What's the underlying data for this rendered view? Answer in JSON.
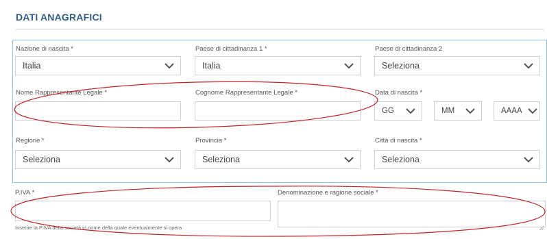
{
  "section": {
    "title": "DATI ANAGRAFICI"
  },
  "fields": {
    "nazione_nascita": {
      "label": "Nazione di nascita  *",
      "value": "Italia"
    },
    "paese_cittadinanza_1": {
      "label": "Paese di cittadinanza 1  *",
      "value": "Italia"
    },
    "paese_cittadinanza_2": {
      "label": "Paese di cittadinanza 2",
      "value": "Seleziona"
    },
    "nome_rappresentante": {
      "label": "Nome Rappresentante Legale *",
      "value": ""
    },
    "cognome_rappresentante": {
      "label": "Cognome Rappresentante Legale *",
      "value": ""
    },
    "data_nascita": {
      "label": "Data di nascita  *",
      "day": "GG",
      "month": "MM",
      "year": "AAAA"
    },
    "regione": {
      "label": "Regione  *",
      "value": "Seleziona"
    },
    "provincia": {
      "label": "Provincia  *",
      "value": "Seleziona"
    },
    "citta_nascita": {
      "label": "Città di nascita  *",
      "value": "Seleziona"
    },
    "piva": {
      "label": "P.IVA  *",
      "value": "",
      "hint": "Inserire la P.IVA della società in nome della quale eventualmente si opera"
    },
    "denominazione": {
      "label": "Denominazione e ragione sociale *",
      "value": ""
    }
  },
  "icons": {
    "dropdown": "chevron-down-icon"
  },
  "colors": {
    "title": "#2f5e8c",
    "frame_border": "#8ec3e6",
    "annotation": "#c0242a"
  }
}
